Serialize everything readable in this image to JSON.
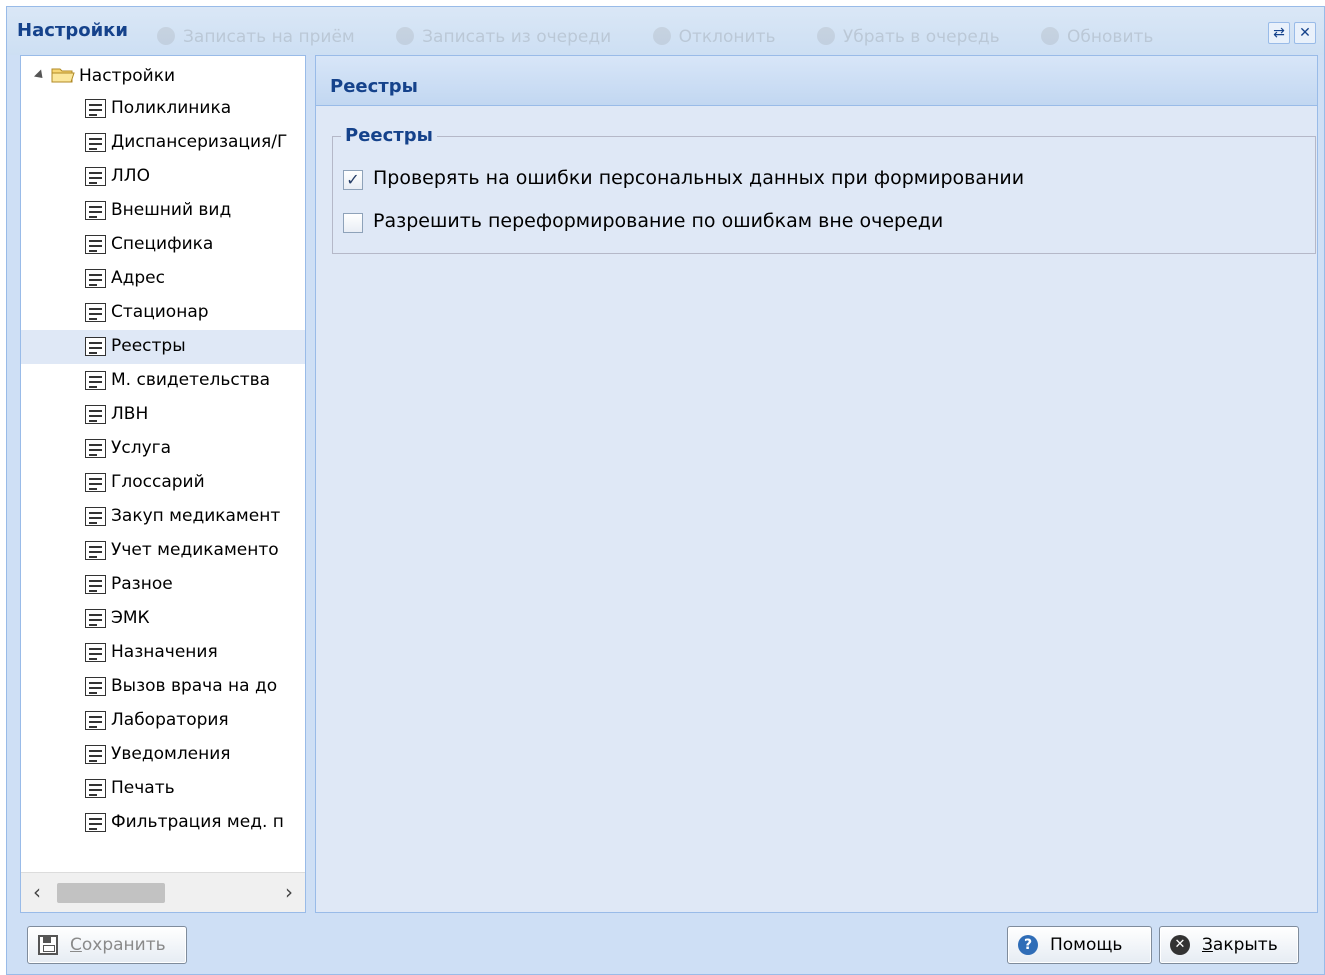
{
  "window": {
    "title": "Настройки",
    "ghost_toolbar": [
      "Записать на приём",
      "Записать из очереди",
      "Отклонить",
      "Убрать в очередь",
      "Обновить"
    ]
  },
  "tree": {
    "root_label": "Настройки",
    "items": [
      "Поликлиника",
      "Диспансеризация/Г",
      "ЛЛО",
      "Внешний вид",
      "Специфика",
      "Адрес",
      "Стационар",
      "Реестры",
      "М. свидетельства",
      "ЛВН",
      "Услуга",
      "Глоссарий",
      "Закуп медикамент",
      "Учет медикаменто",
      "Разное",
      "ЭМК",
      "Назначения",
      "Вызов врача на до",
      "Лаборатория",
      "Уведомления",
      "Печать",
      "Фильтрация мед. п"
    ],
    "selected": "Реестры"
  },
  "panel": {
    "title": "Реестры",
    "group_title": "Реестры",
    "options": [
      {
        "label": "Проверять на ошибки персональных данных при формировании",
        "checked": true
      },
      {
        "label": "Разрешить переформирование по ошибкам вне очереди",
        "checked": false
      }
    ]
  },
  "buttons": {
    "save": "Сохранить",
    "help": "Помощь",
    "close": "Закрыть"
  },
  "colors": {
    "accent": "#15428b",
    "window_bg": "#cedff5",
    "panel_bg": "#dfe8f6",
    "border": "#99bbe8"
  }
}
